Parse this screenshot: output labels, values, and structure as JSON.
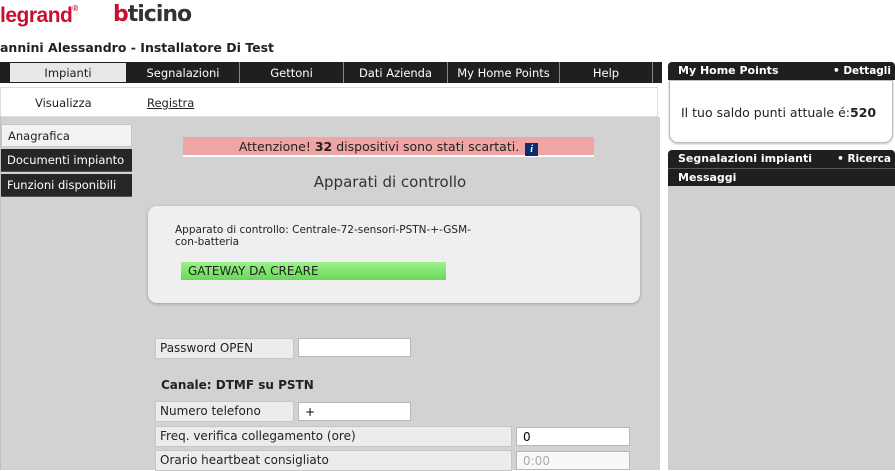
{
  "header": {
    "legrand_logo": "legrand",
    "legrand_reg": "®",
    "bticino_logo_b": "b",
    "bticino_logo_rest": "ticino",
    "user_line": "annini Alessandro - Installatore Di Test"
  },
  "topnav": [
    {
      "label": "Impianti",
      "active": true
    },
    {
      "label": "Segnalazioni"
    },
    {
      "label": "Gettoni"
    },
    {
      "label": "Dati Azienda"
    },
    {
      "label": "My Home Points"
    },
    {
      "label": "Help"
    }
  ],
  "subnav": {
    "visualizza": "Visualizza",
    "registra": "Registra"
  },
  "leftnav": {
    "anagrafica": "Anagrafica",
    "documenti": "Documenti impianto",
    "funzioni": "Funzioni disponibili"
  },
  "alert": {
    "prefix": "Attenzione! ",
    "count": "32",
    "suffix": " dispositivi sono stati scartati.",
    "info_glyph": "i"
  },
  "section_title": "Apparati di controllo",
  "device": {
    "label": "Apparato di controllo: Centrale-72-sensori-PSTN-+-GSM-con-batteria",
    "gateway_status": "GATEWAY DA CREARE"
  },
  "form": {
    "password_label": "Password OPEN",
    "password_value": "",
    "canale_heading": "Canale: DTMF su PSTN",
    "numero_label": "Numero telefono",
    "numero_value": "+",
    "freq_label": "Freq. verifica collegamento (ore)",
    "freq_value": "0",
    "orario_label": "Orario heartbeat consigliato",
    "orario_value": "0:00"
  },
  "right": {
    "points_title": "My Home Points",
    "points_link": "• Dettagli",
    "points_text_prefix": "Il tuo saldo punti attuale é:",
    "points_value": "520",
    "segnalazioni_title": "Segnalazioni impianti",
    "segnalazioni_link": "• Ricerca",
    "messaggi_title": "Messaggi"
  },
  "colors": {
    "brand_red": "#c8102e",
    "nav_dark": "#1f1f1f",
    "alert_bg": "#f0a5a5",
    "gateway_green": "#68d858",
    "info_blue": "#0a2d6e"
  }
}
